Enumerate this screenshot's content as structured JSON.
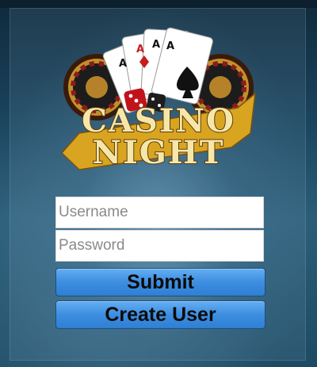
{
  "logo": {
    "line1": "CASINO",
    "line2": "NIGHT"
  },
  "form": {
    "username_placeholder": "Username",
    "username_value": "",
    "password_placeholder": "Password",
    "password_value": "",
    "submit_label": "Submit",
    "create_user_label": "Create User"
  },
  "colors": {
    "button_blue": "#3d8ee0",
    "logo_gold": "#f6e7a8",
    "background_teal": "#1b4660"
  }
}
